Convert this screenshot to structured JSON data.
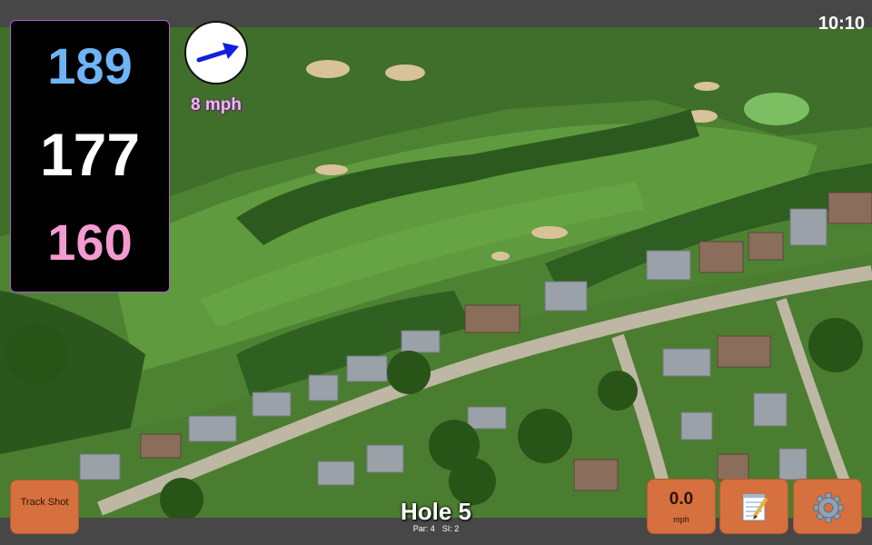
{
  "status": {
    "time": "10:10"
  },
  "distances": {
    "back": "189",
    "middle": "177",
    "front": "160"
  },
  "wind": {
    "speed": "8 mph",
    "direction_icon": "arrow-icon",
    "arrow_color": "#1120e0"
  },
  "hole": {
    "title": "Hole 5",
    "par": "Par: 4",
    "si": "SI: 2"
  },
  "buttons": {
    "track_shot": "Track Shot",
    "speed_value": "0.0",
    "speed_unit": "mph",
    "notes_icon": "notepad-icon",
    "settings_icon": "gear-icon"
  },
  "colors": {
    "button": "#d6703e",
    "back_distance": "#6fb4f5",
    "middle_distance": "#ffffff",
    "front_distance": "#f29bd0",
    "wind_label": "#f6b5f0"
  }
}
